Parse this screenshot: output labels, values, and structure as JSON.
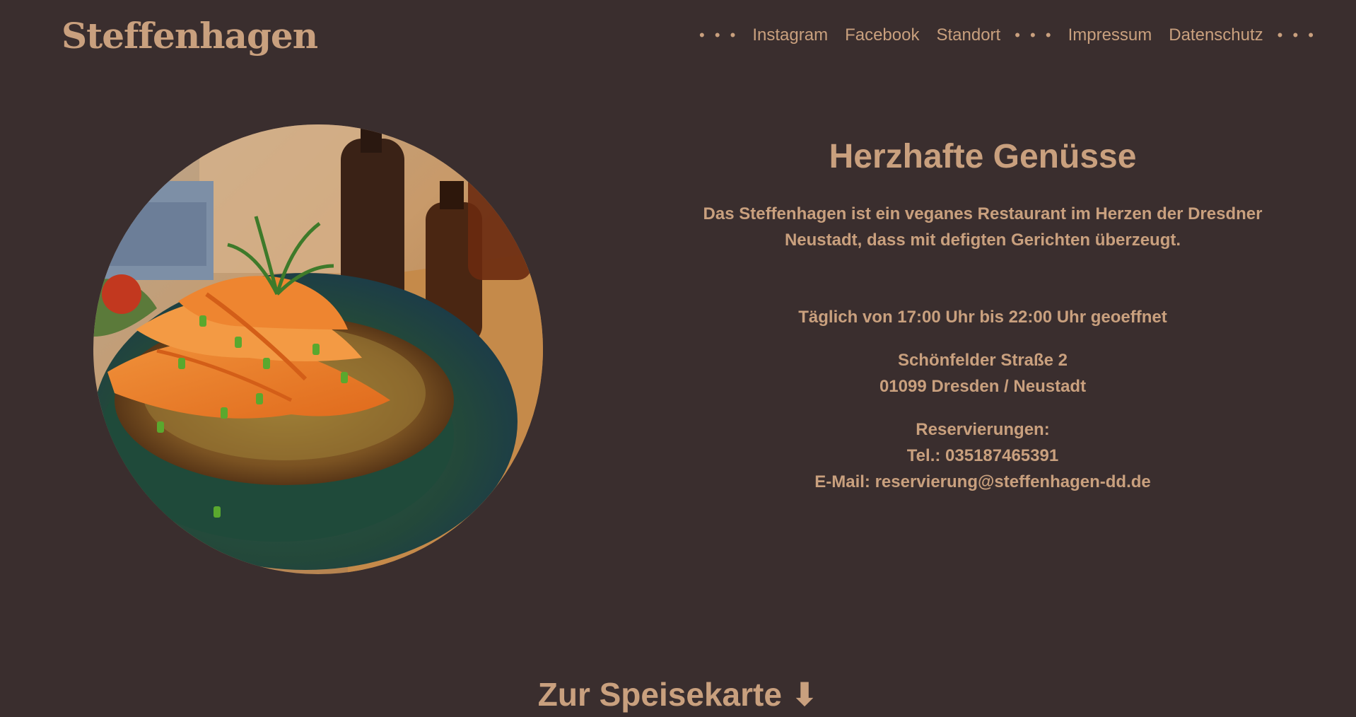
{
  "brand": {
    "logo": "Steffenhagen"
  },
  "nav": {
    "separator": "• • •",
    "items": [
      {
        "label": "Instagram"
      },
      {
        "label": "Facebook"
      },
      {
        "label": "Standort"
      },
      {
        "label": "Impressum"
      },
      {
        "label": "Datenschutz"
      }
    ]
  },
  "hero": {
    "image_alt": "vegan dish: potato rösti topped with carrot ribbons, chives and dill on a green plate"
  },
  "main": {
    "headline": "Herzhafte Genüsse",
    "intro_line1": "Das Steffenhagen ist ein veganes Restaurant im Herzen der Dresdner",
    "intro_line2": "Neustadt, dass mit defigten Gerichten überzeugt.",
    "hours": "Täglich von 17:00 Uhr bis 22:00 Uhr geoeffnet",
    "address_line1": "Schönfelder Straße 2",
    "address_line2": "01099 Dresden / Neustadt",
    "reservation_title": "Reservierungen:",
    "reservation_phone": "Tel.: 035187465391",
    "reservation_email": "E-Mail: reservierung@steffenhagen-dd.de"
  },
  "menu_link": {
    "label": "Zur Speisekarte ⬇"
  },
  "colors": {
    "background": "#3a2e2e",
    "text": "#c9a07e"
  }
}
